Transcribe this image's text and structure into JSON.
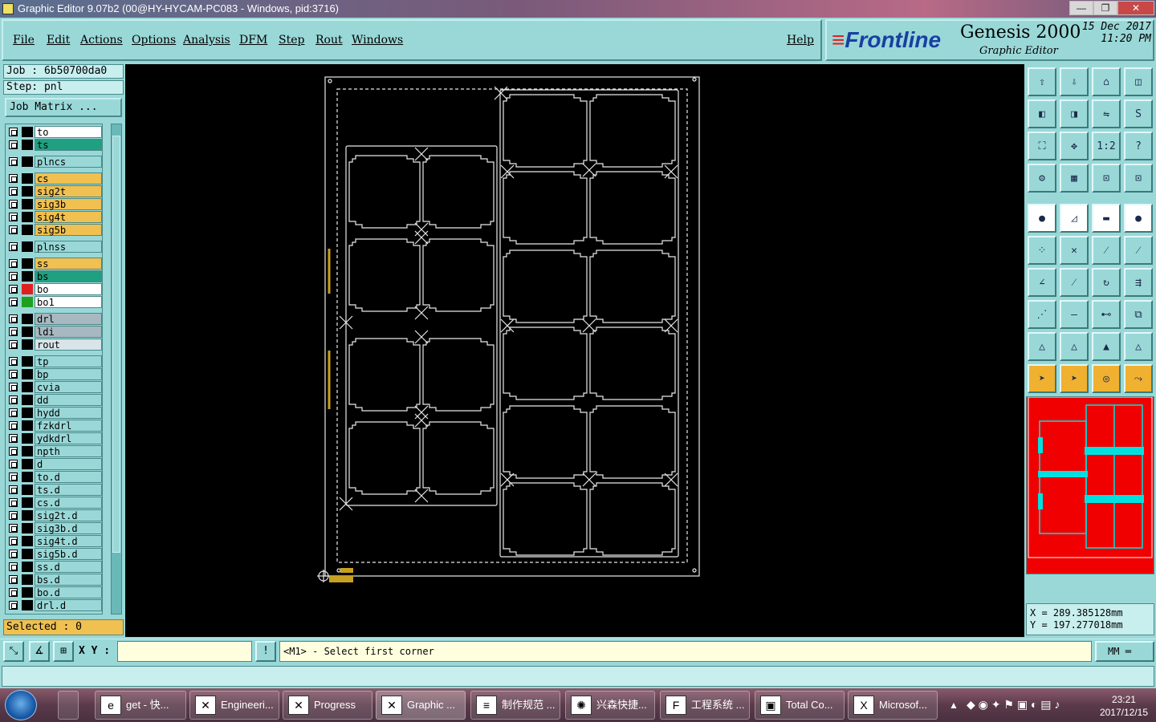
{
  "window": {
    "title": "Graphic Editor 9.07b2 (00@HY-HYCAM-PC083 - Windows, pid:3716)",
    "min_glyph": "—",
    "max_glyph": "❐",
    "close_glyph": "✕"
  },
  "menu": {
    "items": [
      "File",
      "Edit",
      "Actions",
      "Options",
      "Analysis",
      "DFM",
      "Step",
      "Rout",
      "Windows"
    ],
    "help": "Help"
  },
  "brand": {
    "logo": "Frontline",
    "product": "Genesis 2000",
    "subtitle": "Graphic Editor",
    "date": "15 Dec 2017",
    "time": "11:20 PM"
  },
  "job": {
    "job_line": "Job : 6b50700da0",
    "step_line": "Step: pnl",
    "matrix_button": "Job Matrix ..."
  },
  "layers": [
    {
      "name": "to",
      "color": "#ffffff",
      "swatch": "#000000"
    },
    {
      "name": "ts",
      "color": "#20a080",
      "swatch": "#000000"
    },
    {
      "name": "plncs",
      "color": "#9ad8d8",
      "swatch": "#000000"
    },
    {
      "name": "cs",
      "color": "#f0c050",
      "swatch": "#000000"
    },
    {
      "name": "sig2t",
      "color": "#f0c050",
      "swatch": "#000000"
    },
    {
      "name": "sig3b",
      "color": "#f0c050",
      "swatch": "#000000"
    },
    {
      "name": "sig4t",
      "color": "#f0c050",
      "swatch": "#000000"
    },
    {
      "name": "sig5b",
      "color": "#f0c050",
      "swatch": "#000000"
    },
    {
      "name": "plnss",
      "color": "#9ad8d8",
      "swatch": "#000000"
    },
    {
      "name": "ss",
      "color": "#f0c050",
      "swatch": "#000000"
    },
    {
      "name": "bs",
      "color": "#20a080",
      "swatch": "#000000"
    },
    {
      "name": "bo",
      "color": "#ffffff",
      "swatch": "#e02020"
    },
    {
      "name": "bo1",
      "color": "#ffffff",
      "swatch": "#20a020"
    },
    {
      "name": "drl",
      "color": "#a8b8c0",
      "swatch": "#000000"
    },
    {
      "name": "ldi",
      "color": "#a8b8c0",
      "swatch": "#000000"
    },
    {
      "name": "rout",
      "color": "#d8e4e8",
      "swatch": "#000000"
    },
    {
      "name": "tp",
      "color": "#9ad8d8",
      "swatch": "#000000"
    },
    {
      "name": "bp",
      "color": "#9ad8d8",
      "swatch": "#000000"
    },
    {
      "name": "cvia",
      "color": "#9ad8d8",
      "swatch": "#000000"
    },
    {
      "name": "dd",
      "color": "#9ad8d8",
      "swatch": "#000000"
    },
    {
      "name": "hydd",
      "color": "#9ad8d8",
      "swatch": "#000000"
    },
    {
      "name": "fzkdrl",
      "color": "#9ad8d8",
      "swatch": "#000000"
    },
    {
      "name": "ydkdrl",
      "color": "#9ad8d8",
      "swatch": "#000000"
    },
    {
      "name": "npth",
      "color": "#9ad8d8",
      "swatch": "#000000"
    },
    {
      "name": "d",
      "color": "#9ad8d8",
      "swatch": "#000000"
    },
    {
      "name": "to.d",
      "color": "#9ad8d8",
      "swatch": "#000000"
    },
    {
      "name": "ts.d",
      "color": "#9ad8d8",
      "swatch": "#000000"
    },
    {
      "name": "cs.d",
      "color": "#9ad8d8",
      "swatch": "#000000"
    },
    {
      "name": "sig2t.d",
      "color": "#9ad8d8",
      "swatch": "#000000"
    },
    {
      "name": "sig3b.d",
      "color": "#9ad8d8",
      "swatch": "#000000"
    },
    {
      "name": "sig4t.d",
      "color": "#9ad8d8",
      "swatch": "#000000"
    },
    {
      "name": "sig5b.d",
      "color": "#9ad8d8",
      "swatch": "#000000"
    },
    {
      "name": "ss.d",
      "color": "#9ad8d8",
      "swatch": "#000000"
    },
    {
      "name": "bs.d",
      "color": "#9ad8d8",
      "swatch": "#000000"
    },
    {
      "name": "bo.d",
      "color": "#9ad8d8",
      "swatch": "#000000"
    },
    {
      "name": "drl.d",
      "color": "#9ad8d8",
      "swatch": "#000000"
    }
  ],
  "selected": "Selected : 0",
  "coords": {
    "x": "X = 289.385128mm",
    "y": "Y = 197.277018mm"
  },
  "commandbar": {
    "xy_label": "X Y :",
    "xy_value": "",
    "alert_glyph": "!",
    "prompt": "<M1> - Select first corner",
    "units": "MM"
  },
  "toolbar_icons": [
    "layer-up-icon",
    "layer-down-icon",
    "home-icon",
    "split-window-icon",
    "step-left-icon",
    "step-right-icon",
    "mirror-icon",
    "rotate-icon",
    "zoom-fit-icon",
    "pan-icon",
    "scale-icon",
    "help-icon",
    "settings-icon",
    "grid-icon",
    "snap-icon",
    "snap-active-icon",
    "select-pad-icon",
    "select-shape-icon",
    "measure-icon",
    "dot-icon",
    "net-icon",
    "cross-icon",
    "line-icon",
    "line2-icon",
    "angle-icon",
    "draw-icon",
    "arc-icon",
    "pins-icon",
    "vertex-icon",
    "cut-icon",
    "resize-icon",
    "group-icon",
    "triangle-icon",
    "triangle-up-icon",
    "triangle-fill-icon",
    "triangle-cut-icon",
    "pointer-icon",
    "select-icon",
    "circle-select-icon",
    "route-select-icon"
  ],
  "taskbar": {
    "tasks": [
      "get - 快...",
      "Engineeri...",
      "Progress",
      "Graphic ...",
      "制作规范 ...",
      "兴森快捷...",
      "工程系统 ...",
      "Total Co...",
      "Microsof..."
    ],
    "time": "23:21",
    "date": "2017/12/15"
  },
  "colors": {
    "panel": "#9ad8d8",
    "canvas": "#000000",
    "outline": "#e8e8e8",
    "minimap_bg": "#f00000",
    "minimap_outline": "#00e0e0"
  }
}
